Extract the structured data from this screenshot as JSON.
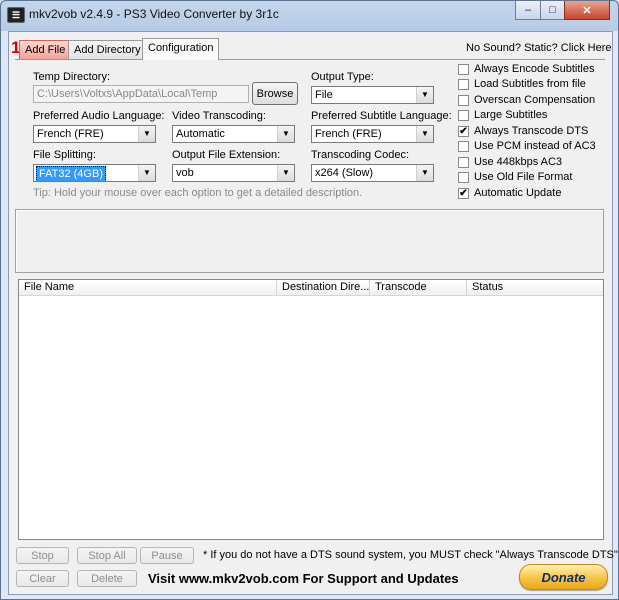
{
  "window": {
    "title": "mkv2vob v2.4.9 - PS3 Video Converter by 3r1c",
    "icon": "film-icon",
    "minimize_glyph": "–",
    "maximize_glyph": "□",
    "close_glyph": "✕"
  },
  "tabs": [
    {
      "label": "Add File",
      "highlighted": true
    },
    {
      "label": "Add Directory"
    },
    {
      "label": "Configuration",
      "active": true
    }
  ],
  "annotation_number": "1",
  "help_link": "No Sound? Static? Click Here",
  "config": {
    "temp_directory": {
      "label": "Temp Directory:",
      "value": "C:\\Users\\Voltxs\\AppData\\Local\\Temp",
      "button": "Browse"
    },
    "output_type": {
      "label": "Output Type:",
      "value": "File"
    },
    "preferred_audio_language": {
      "label": "Preferred Audio Language:",
      "value": "French (FRE)"
    },
    "video_transcoding": {
      "label": "Video Transcoding:",
      "value": "Automatic"
    },
    "preferred_subtitle_language": {
      "label": "Preferred Subtitle Language:",
      "value": "French (FRE)"
    },
    "file_splitting": {
      "label": "File Splitting:",
      "value": "FAT32 (4GB)"
    },
    "output_file_extension": {
      "label": "Output File Extension:",
      "value": "vob"
    },
    "transcoding_codec": {
      "label": "Transcoding Codec:",
      "value": "x264 (Slow)"
    },
    "tip": "Tip: Hold your mouse over each option to get a detailed description.",
    "dropdown_glyph": "▼"
  },
  "options": [
    {
      "label": "Always Encode Subtitles",
      "checked": false
    },
    {
      "label": "Load Subtitles from file",
      "checked": false
    },
    {
      "label": "Overscan Compensation",
      "checked": false
    },
    {
      "label": "Large Subtitles",
      "checked": false
    },
    {
      "label": "Always Transcode DTS",
      "checked": true
    },
    {
      "label": "Use PCM instead of AC3",
      "checked": false
    },
    {
      "label": "Use 448kbps AC3",
      "checked": false
    },
    {
      "label": "Use Old File Format",
      "checked": false
    },
    {
      "label": "Automatic Update",
      "checked": true
    }
  ],
  "check_glyph": "✔",
  "table": {
    "columns": [
      "File Name",
      "Destination Dire...",
      "Transcode",
      "Status"
    ],
    "rows": []
  },
  "bottom": {
    "stop": "Stop",
    "stop_all": "Stop All",
    "pause": "Pause",
    "clear": "Clear",
    "delete": "Delete",
    "dts_note": "* If you do not have a DTS sound system, you MUST check \"Always Transcode DTS\"",
    "visit": "Visit www.mkv2vob.com For Support and Updates",
    "donate": "Donate"
  }
}
